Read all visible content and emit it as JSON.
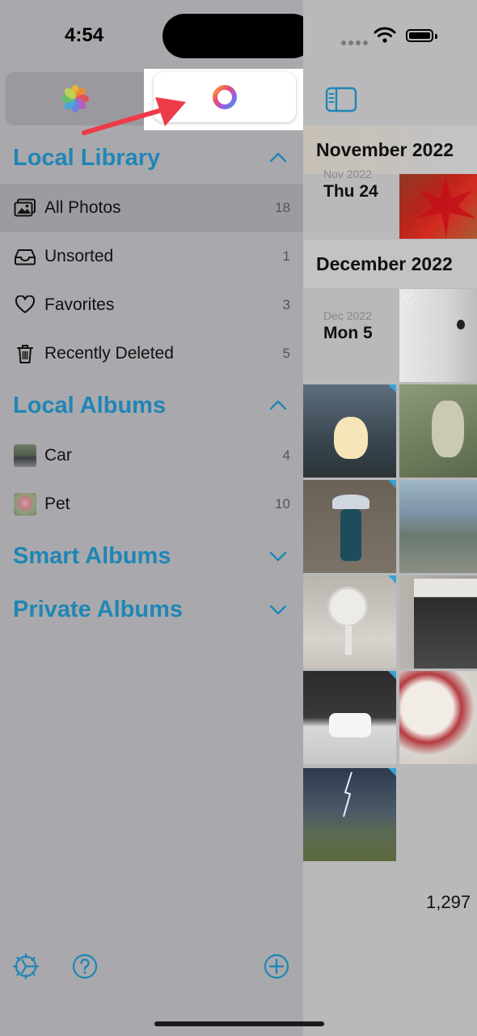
{
  "status_bar": {
    "time": "4:54"
  },
  "sidebar": {
    "sections": {
      "local_library": {
        "title": "Local Library",
        "items": [
          {
            "label": "All Photos",
            "count": "18"
          },
          {
            "label": "Unsorted",
            "count": "1"
          },
          {
            "label": "Favorites",
            "count": "3"
          },
          {
            "label": "Recently Deleted",
            "count": "5"
          }
        ]
      },
      "local_albums": {
        "title": "Local Albums",
        "items": [
          {
            "label": "Car",
            "count": "4"
          },
          {
            "label": "Pet",
            "count": "10"
          }
        ]
      },
      "smart_albums": {
        "title": "Smart Albums"
      },
      "private_albums": {
        "title": "Private Albums"
      }
    }
  },
  "timeline": {
    "groups": [
      {
        "month": "November 2022",
        "day_small": "Nov 2022",
        "day_big": "Thu 24"
      },
      {
        "month": "December 2022",
        "day_small": "Dec 2022",
        "day_big": "Mon 5"
      }
    ],
    "footer_count": "1,297"
  },
  "colors": {
    "accent": "#1f86b5",
    "annotation_arrow": "#ee3b4a"
  },
  "icons": {
    "segment_left": "photos-app-icon",
    "segment_right": "ring-app-icon",
    "sidebar_toggle": "sidebar-toggle-icon",
    "bottom": [
      "settings-icon",
      "help-icon",
      "add-icon"
    ]
  }
}
